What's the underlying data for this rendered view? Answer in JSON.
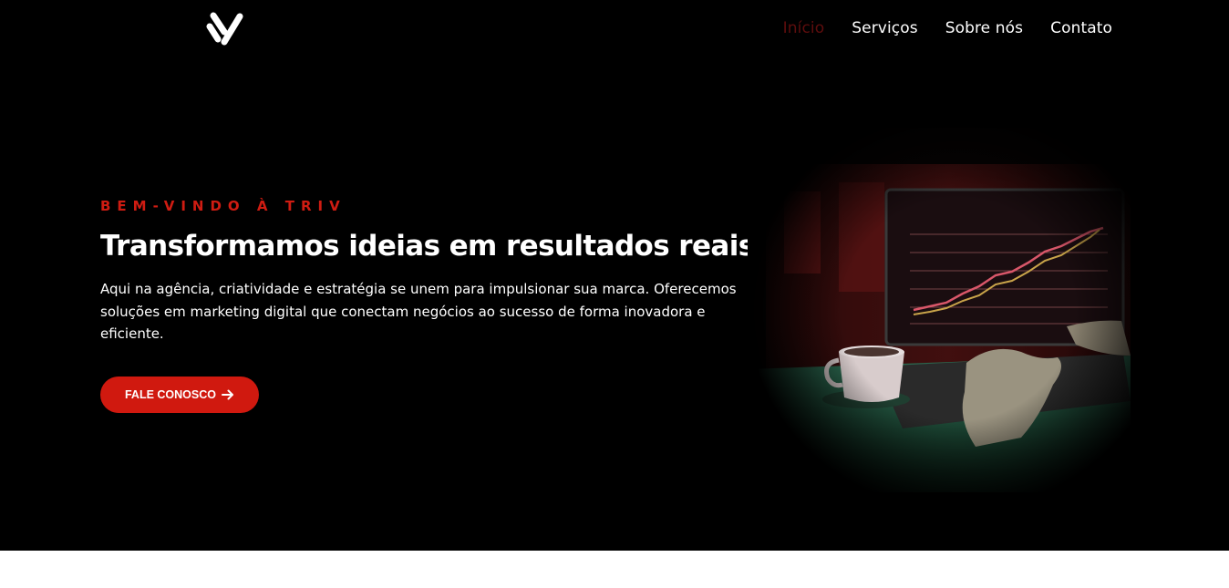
{
  "header": {
    "logo_icon": "triv-logo-icon",
    "nav": [
      {
        "label": "Início",
        "active": true
      },
      {
        "label": "Serviços",
        "active": false
      },
      {
        "label": "Sobre nós",
        "active": false
      },
      {
        "label": "Contato",
        "active": false
      }
    ]
  },
  "hero": {
    "eyebrow": "BEM-VINDO À TRIV",
    "title": "Transformamos ideias em resultados reais.",
    "description": "Aqui na agência, criatividade e estratégia se unem para impulsionar sua marca. Oferecemos soluções em marketing digital que conectam negócios ao sucesso de forma inovadora e eficiente.",
    "cta_label": "FALE CONOSCO",
    "cta_icon": "arrow-right-icon",
    "image": "laptop-growth-chart-photo"
  },
  "colors": {
    "hero_background": "#000000",
    "accent": "#d0190f",
    "nav_active": "#5e0d0d",
    "text": "#ffffff"
  }
}
